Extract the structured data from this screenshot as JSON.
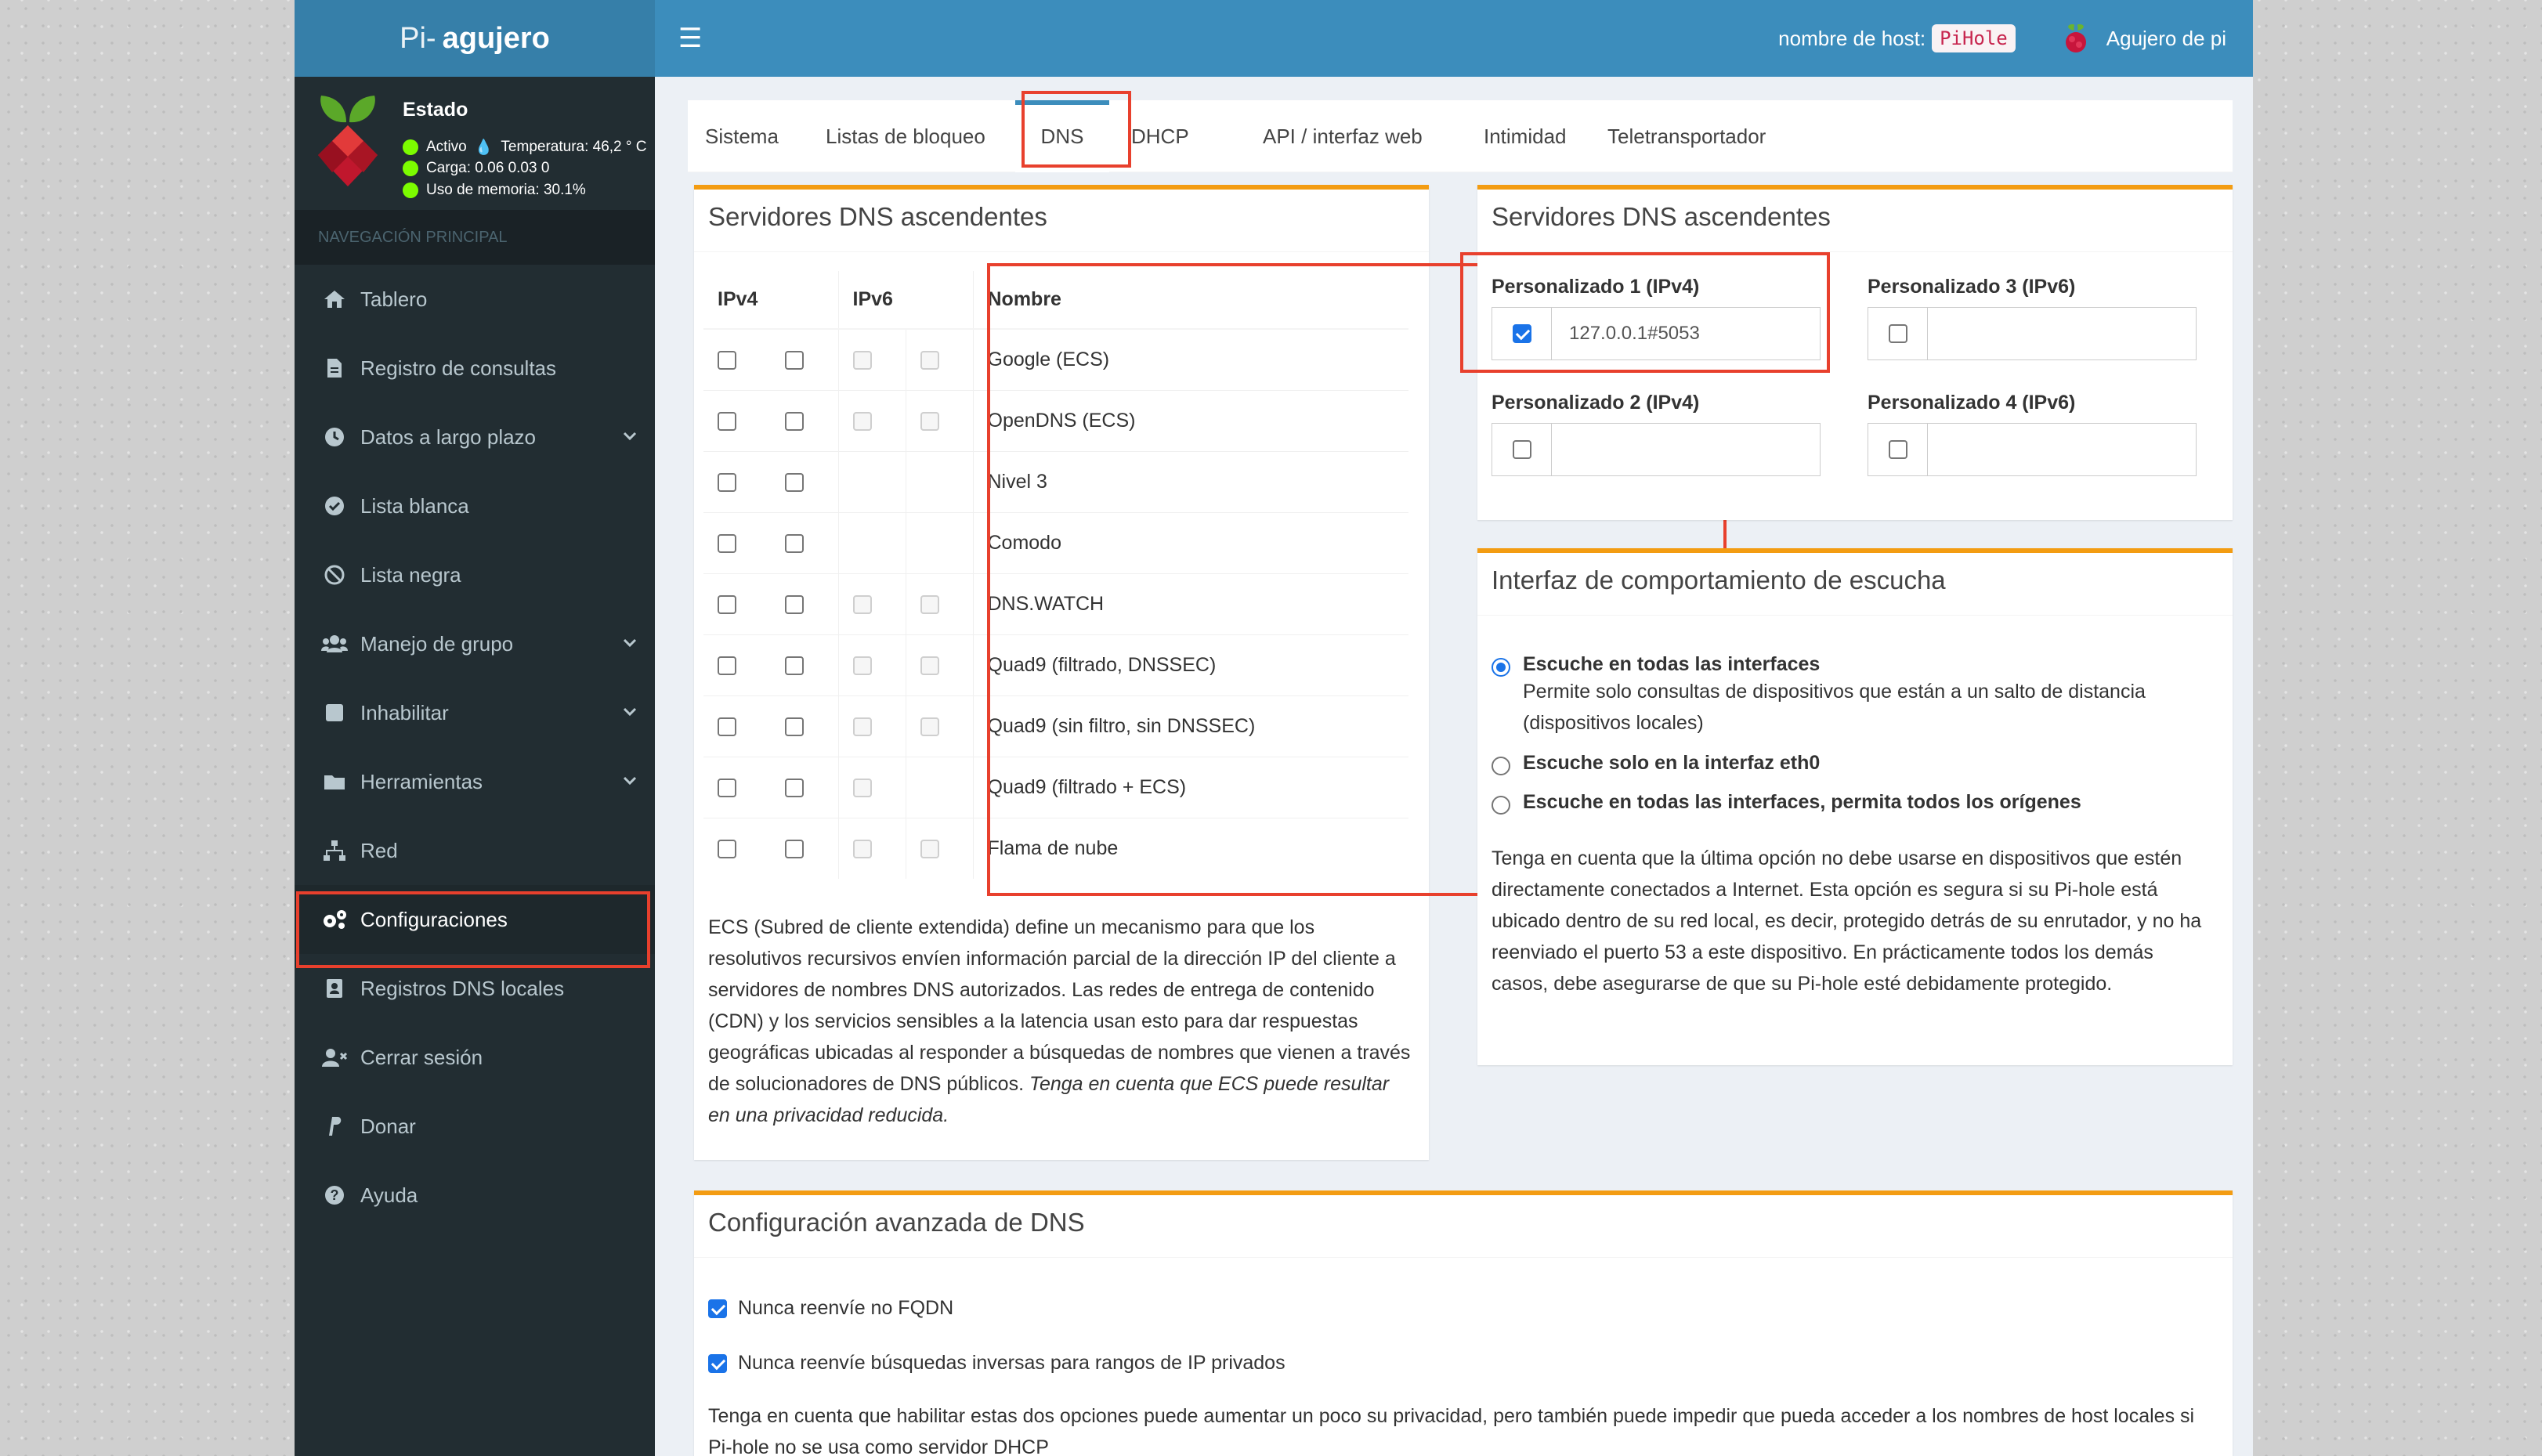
{
  "brand": {
    "light": "Pi-",
    "bold": "agujero"
  },
  "header": {
    "hostname_label": "nombre de host:",
    "hostname_value": "PiHole",
    "user_name": "Agujero de pi"
  },
  "status": {
    "title": "Estado",
    "active": "Activo",
    "temperature": "Temperatura: 46,2 ° C",
    "load": "Carga: 0.06 0.03 0",
    "memory": "Uso de memoria: 30.1%"
  },
  "sidebar": {
    "heading": "NAVEGACIÓN PRINCIPAL",
    "items": [
      {
        "label": "Tablero",
        "icon": "home-icon"
      },
      {
        "label": "Registro de consultas",
        "icon": "file-icon"
      },
      {
        "label": "Datos a largo plazo",
        "icon": "clock-icon"
      },
      {
        "label": "Lista blanca",
        "icon": "check-circle-icon"
      },
      {
        "label": "Lista negra",
        "icon": "ban-icon"
      },
      {
        "label": "Manejo de grupo",
        "icon": "users-icon"
      },
      {
        "label": "Inhabilitar",
        "icon": "stop-icon"
      },
      {
        "label": "Herramientas",
        "icon": "folder-icon"
      },
      {
        "label": "Red",
        "icon": "network-icon"
      },
      {
        "label": "Configuraciones",
        "icon": "gears-icon"
      },
      {
        "label": "Registros DNS locales",
        "icon": "address-book-icon"
      },
      {
        "label": "Cerrar sesión",
        "icon": "user-times-icon"
      },
      {
        "label": "Donar",
        "icon": "paypal-icon"
      },
      {
        "label": "Ayuda",
        "icon": "question-icon"
      }
    ]
  },
  "tabs": [
    "Sistema",
    "Listas de bloqueo",
    "DNS",
    "DHCP",
    "API / interfaz web",
    "Intimidad",
    "Teletransportador"
  ],
  "upstream": {
    "title": "Servidores DNS ascendentes",
    "headers": {
      "ipv4": "IPv4",
      "ipv6": "IPv6",
      "name": "Nombre"
    },
    "rows": [
      {
        "name": "Google (ECS)",
        "v6": [
          true,
          true
        ]
      },
      {
        "name": "OpenDNS (ECS)",
        "v6": [
          true,
          true
        ]
      },
      {
        "name": "Nivel 3",
        "v6": [
          false,
          false
        ]
      },
      {
        "name": "Comodo",
        "v6": [
          false,
          false
        ]
      },
      {
        "name": "DNS.WATCH",
        "v6": [
          true,
          true
        ]
      },
      {
        "name": "Quad9 (filtrado, DNSSEC)",
        "v6": [
          true,
          true
        ]
      },
      {
        "name": "Quad9 (sin filtro, sin DNSSEC)",
        "v6": [
          true,
          true
        ]
      },
      {
        "name": "Quad9 (filtrado + ECS)",
        "v6": [
          true,
          false
        ]
      },
      {
        "name": "Flama de nube",
        "v6": [
          true,
          true
        ]
      }
    ],
    "ecs_note": "ECS (Subred de cliente extendida) define un mecanismo para que los resolutivos recursivos envíen información parcial de la dirección IP del cliente a servidores de nombres DNS autorizados. Las redes de entrega de contenido (CDN) y los servicios sensibles a la latencia usan esto para dar respuestas geográficas ubicadas al responder a búsquedas de nombres que vienen a través de solucionadores de DNS públicos.",
    "ecs_note_em": "Tenga en cuenta que ECS puede resultar en una privacidad reducida."
  },
  "custom": {
    "title": "Servidores DNS ascendentes",
    "c1": {
      "label": "Personalizado 1 (IPv4)",
      "value": "127.0.0.1#5053",
      "checked": true
    },
    "c2": {
      "label": "Personalizado 2 (IPv4)",
      "value": "",
      "checked": false
    },
    "c3": {
      "label": "Personalizado 3 (IPv6)",
      "value": "",
      "checked": false
    },
    "c4": {
      "label": "Personalizado 4 (IPv6)",
      "value": "",
      "checked": false
    }
  },
  "listen": {
    "title": "Interfaz de comportamiento de escucha",
    "opt1": "Escuche en todas las interfaces",
    "opt1_desc": "Permite solo consultas de dispositivos que están a un salto de distancia (dispositivos locales)",
    "opt2": "Escuche solo en la interfaz eth0",
    "opt3": "Escuche en todas las interfaces, permita todos los orígenes",
    "note": "Tenga en cuenta que la última opción no debe usarse en dispositivos que estén directamente conectados a Internet. Esta opción es segura si su Pi-hole está ubicado dentro de su red local, es decir, protegido detrás de su enrutador, y no ha reenviado el puerto 53 a este dispositivo. En prácticamente todos los demás casos, debe asegurarse de que su Pi-hole esté debidamente protegido."
  },
  "advanced": {
    "title": "Configuración avanzada de DNS",
    "opt1": "Nunca reenvíe no FQDN",
    "opt2": "Nunca reenvíe búsquedas inversas para rangos de IP privados",
    "note": "Tenga en cuenta que habilitar estas dos opciones puede aumentar un poco su privacidad, pero también puede impedir que pueda acceder a los nombres de host locales si Pi-hole no se usa como servidor DHCP"
  }
}
